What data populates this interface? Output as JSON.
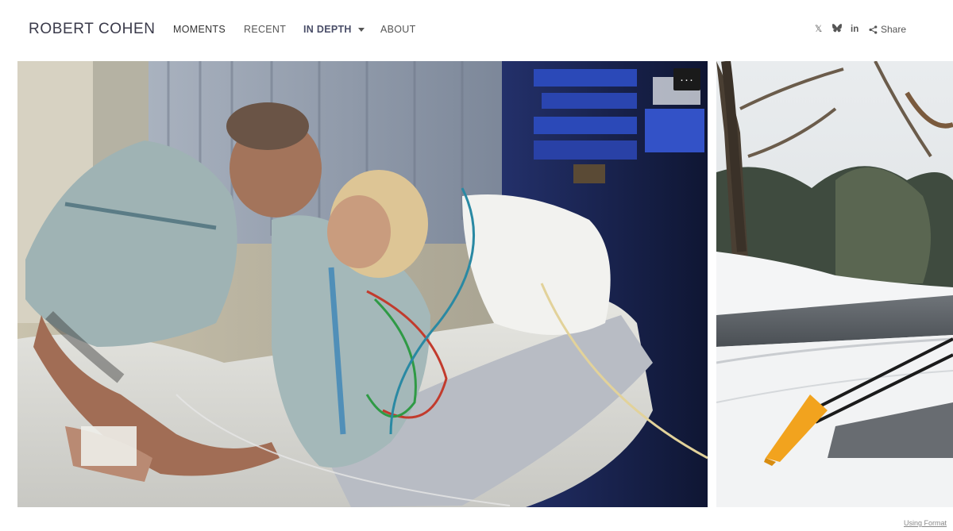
{
  "site": {
    "title": "ROBERT COHEN"
  },
  "nav": {
    "items": [
      {
        "label": "MOMENTS"
      },
      {
        "label": "RECENT"
      },
      {
        "label": "IN DEPTH"
      },
      {
        "label": "ABOUT"
      }
    ]
  },
  "social": {
    "x_icon": "𝕏",
    "bluesky_icon": "butterfly-icon",
    "linkedin_label": "in",
    "share_label": "Share"
  },
  "gallery": {
    "more_label": "···"
  },
  "footer": {
    "using_format": "Using Format"
  }
}
